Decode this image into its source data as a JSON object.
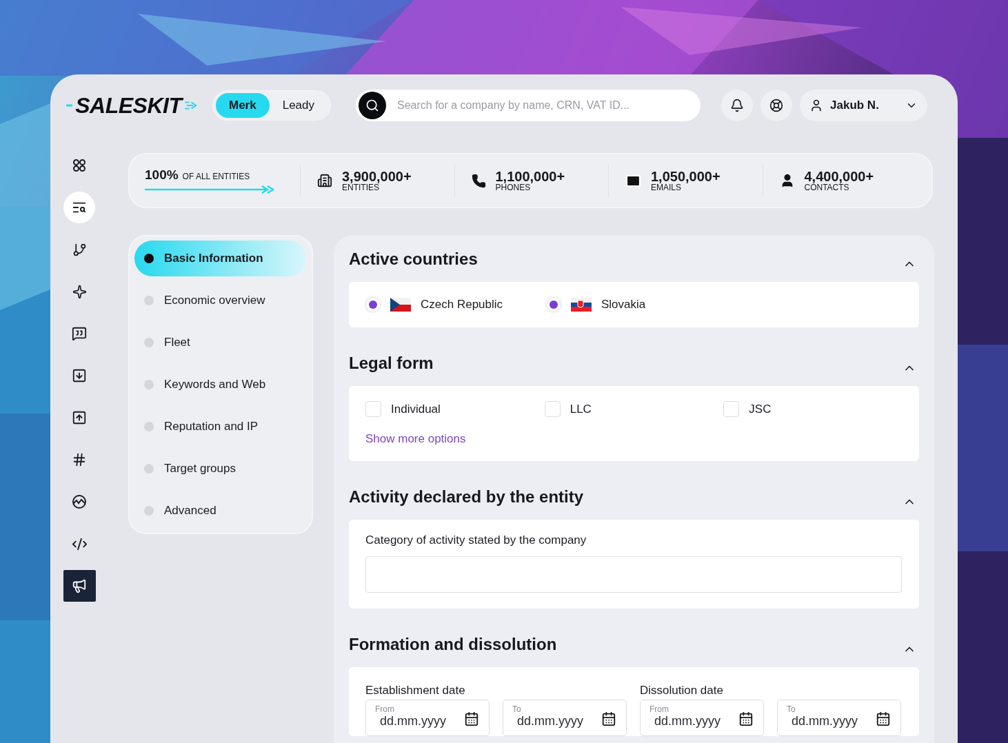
{
  "logo": "SALESKIT",
  "modes": [
    {
      "label": "Merk",
      "selected": true
    },
    {
      "label": "Leady",
      "selected": false
    }
  ],
  "search": {
    "placeholder": "Search for a company by name, CRN, VAT ID..."
  },
  "user": {
    "name": "Jakub N."
  },
  "rail": [
    {
      "kind": "nav",
      "selected": false
    },
    {
      "kind": "nav",
      "selected": true
    },
    {
      "kind": "nav",
      "selected": false
    },
    {
      "kind": "nav",
      "selected": false
    },
    {
      "kind": "nav",
      "selected": false
    },
    {
      "kind": "nav",
      "selected": false
    },
    {
      "kind": "nav",
      "selected": false
    },
    {
      "kind": "nav",
      "selected": false
    },
    {
      "kind": "nav",
      "selected": false
    },
    {
      "kind": "nav",
      "selected": false
    },
    {
      "kind": "accent",
      "selected": false
    }
  ],
  "coverage": {
    "value": "100%",
    "label": "OF ALL ENTITIES"
  },
  "stats": [
    {
      "value": "3,900,000+",
      "label": "ENTITIES"
    },
    {
      "value": "1,100,000+",
      "label": "PHONES"
    },
    {
      "value": "1,050,000+",
      "label": "EMAILS"
    },
    {
      "value": "4,400,000+",
      "label": "CONTACTS"
    }
  ],
  "section_nav": [
    {
      "label": "Basic Information",
      "selected": true
    },
    {
      "label": "Economic overview",
      "selected": false
    },
    {
      "label": "Fleet",
      "selected": false
    },
    {
      "label": "Keywords and Web",
      "selected": false
    },
    {
      "label": "Reputation and IP",
      "selected": false
    },
    {
      "label": "Target groups",
      "selected": false
    },
    {
      "label": "Advanced",
      "selected": false
    }
  ],
  "sections": [
    {
      "kind": "radios",
      "title": "Active countries",
      "expanded": true,
      "options": [
        {
          "label": "Czech Republic",
          "checked": true
        },
        {
          "label": "Slovakia",
          "checked": true
        }
      ]
    },
    {
      "kind": "checkboxes",
      "title": "Legal form",
      "expanded": true,
      "options": [
        {
          "label": "Individual",
          "checked": false
        },
        {
          "label": "LLC",
          "checked": false
        },
        {
          "label": "JSC",
          "checked": false
        }
      ],
      "link": "Show more options"
    },
    {
      "kind": "field",
      "title": "Activity declared by the entity",
      "expanded": true,
      "label": "Category of activity stated by the company"
    },
    {
      "kind": "dates",
      "title": "Formation and dissolution",
      "expanded": true,
      "groups": [
        {
          "label": "Establishment date",
          "fields": [
            {
              "label": "From",
              "placeholder": "dd.mm.yyyy"
            },
            {
              "label": "To",
              "placeholder": "dd.mm.yyyy"
            }
          ]
        },
        {
          "label": "Dissolution date",
          "fields": [
            {
              "label": "From",
              "placeholder": "dd.mm.yyyy"
            },
            {
              "label": "To",
              "placeholder": "dd.mm.yyyy"
            }
          ]
        }
      ]
    }
  ]
}
